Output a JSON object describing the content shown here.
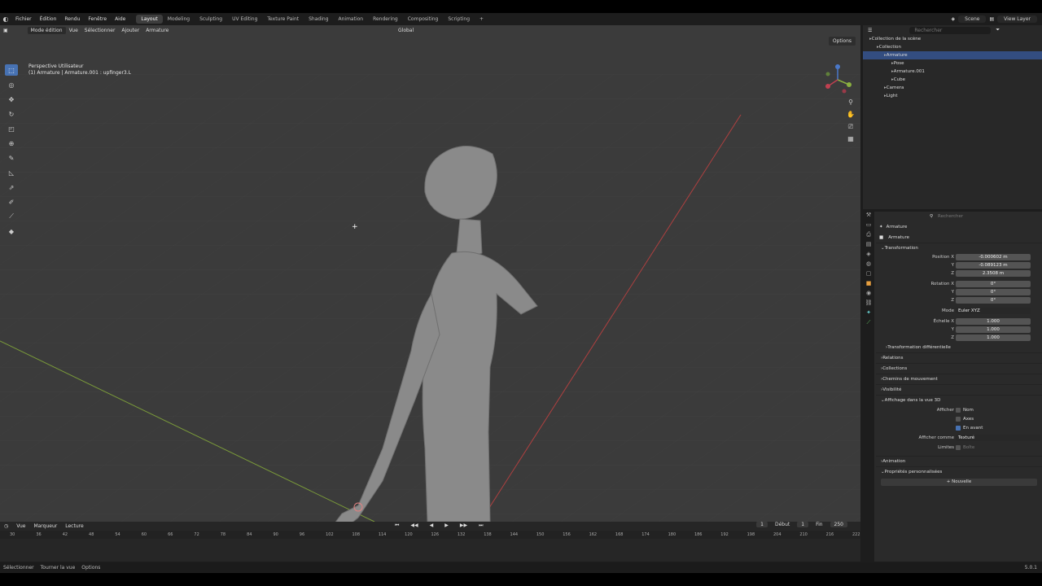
{
  "menu": {
    "items": [
      "Fichier",
      "Édition",
      "Rendu",
      "Fenêtre",
      "Aide"
    ],
    "workspaces": [
      "Layout",
      "Modeling",
      "Sculpting",
      "UV Editing",
      "Texture Paint",
      "Shading",
      "Animation",
      "Rendering",
      "Compositing",
      "Scripting"
    ],
    "scene": "Scene",
    "view_layer": "View Layer"
  },
  "viewport": {
    "mode": "Mode édition",
    "menus": [
      "Vue",
      "Sélectionner",
      "Ajouter",
      "Armature"
    ],
    "orientation": "Global",
    "options": "Options",
    "perspective": "Perspective Utilisateur",
    "object_info": "(1) Armature | Armature.001 : upfinger3.L"
  },
  "timeline": {
    "menus": [
      "Vue",
      "Marqueur",
      "Lecture"
    ],
    "current_frame": "1",
    "start_label": "Début",
    "start": "1",
    "end_label": "Fin",
    "end": "250",
    "ticks": [
      "30",
      "36",
      "42",
      "48",
      "54",
      "60",
      "66",
      "72",
      "78",
      "84",
      "90",
      "96",
      "102",
      "108",
      "114",
      "120",
      "126",
      "132",
      "138",
      "144",
      "150",
      "156",
      "162",
      "168",
      "174",
      "180",
      "186",
      "192",
      "198",
      "204",
      "210",
      "216",
      "222"
    ]
  },
  "status": {
    "items": [
      "Sélectionner",
      "Tourner la vue",
      "Options"
    ],
    "version": "5.0.1"
  },
  "outliner": {
    "search_placeholder": "Rechercher",
    "rows": [
      {
        "label": "Collection de la scène",
        "indent": 0,
        "selected": false
      },
      {
        "label": "Collection",
        "indent": 1,
        "selected": false
      },
      {
        "label": "Armature",
        "indent": 2,
        "selected": true
      },
      {
        "label": "Pose",
        "indent": 3,
        "selected": false
      },
      {
        "label": "Armature.001",
        "indent": 3,
        "selected": false
      },
      {
        "label": "Cube",
        "indent": 3,
        "selected": false
      },
      {
        "label": "Camera",
        "indent": 2,
        "selected": false
      },
      {
        "label": "Light",
        "indent": 2,
        "selected": false
      }
    ]
  },
  "properties": {
    "search_placeholder": "Rechercher",
    "object_name": "Armature",
    "data_name": "Armature",
    "transform_title": "Transformation",
    "position_label": "Position X",
    "position": [
      "-0.000602 m",
      "-0.089123 m",
      "2.3508 m"
    ],
    "rotation_label": "Rotation X",
    "rotation": [
      "0°",
      "0°",
      "0°"
    ],
    "mode_label": "Mode",
    "mode": "Euler XYZ",
    "scale_label": "Échelle X",
    "scale": [
      "1.000",
      "1.000",
      "1.000"
    ],
    "axis_y": "Y",
    "axis_z": "Z",
    "delta": "Transformation différentielle",
    "sections": [
      "Relations",
      "Collections",
      "Chemins de mouvement",
      "Visibilité"
    ],
    "viewport_display": "Affichage dans la vue 3D",
    "show_label": "Afficher",
    "show_name": "Nom",
    "show_axes": "Axes",
    "show_front": "En avant",
    "display_as_label": "Afficher comme",
    "display_as": "Texturé",
    "bounds_label": "Limites",
    "bounds": "Boîte",
    "animation": "Animation",
    "custom_props": "Propriétés personnalisées",
    "new_button": "Nouvelle"
  }
}
